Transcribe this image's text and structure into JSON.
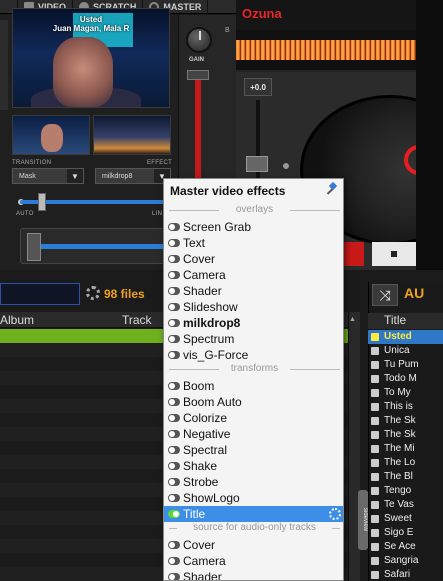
{
  "tabs": [
    {
      "label": "VIDEO"
    },
    {
      "label": "SCRATCH"
    },
    {
      "label": "MASTER"
    }
  ],
  "video": {
    "overlay_line1": "Usted",
    "overlay_line2": "Juan Magan, Mala R",
    "transition_label": "TRANSITION",
    "effect_label": "EFFECT",
    "transition_value": "Mask",
    "effect_value": "milkdrop8",
    "auto_label": "AUTO",
    "link_label": "LIN"
  },
  "master": {
    "gain_label": "GAIN",
    "b_label": "B"
  },
  "deck": {
    "title": "Ozuna",
    "pitch_value": "+0.0"
  },
  "browser": {
    "file_count": "98 files",
    "col_album": "Album",
    "col_track": "Track",
    "side_tab": "sideview"
  },
  "songlist": {
    "title": "AU",
    "col_title": "Title",
    "rows": [
      "Usted",
      "Unica",
      "Tu Pum",
      "Todo M",
      "To My",
      "This is",
      "The Sk",
      "The Sk",
      "The Mi",
      "The Lo",
      "The Bl",
      "Tengo",
      "Te Vas",
      "Sweet",
      "Sigo E",
      "Se Ace",
      "Sangria",
      "Safari"
    ]
  },
  "popup": {
    "title": "Master video effects",
    "sections": {
      "overlays": "overlays",
      "transforms": "transforms",
      "audio_only": "source for audio-only tracks"
    },
    "overlays": [
      "Screen Grab",
      "Text",
      "Cover",
      "Camera",
      "Shader",
      "Slideshow",
      "milkdrop8",
      "Spectrum",
      "vis_G-Force"
    ],
    "transforms": [
      "Boom",
      "Boom Auto",
      "Colorize",
      "Negative",
      "Spectral",
      "Shake",
      "Strobe",
      "ShowLogo",
      "Title"
    ],
    "audio_only": [
      "Cover",
      "Camera",
      "Shader"
    ]
  },
  "colors": {
    "accent": "#3d8ee6",
    "orange": "#f0a020",
    "deck_red": "#e8262a",
    "green_row": "#6fb01e"
  }
}
